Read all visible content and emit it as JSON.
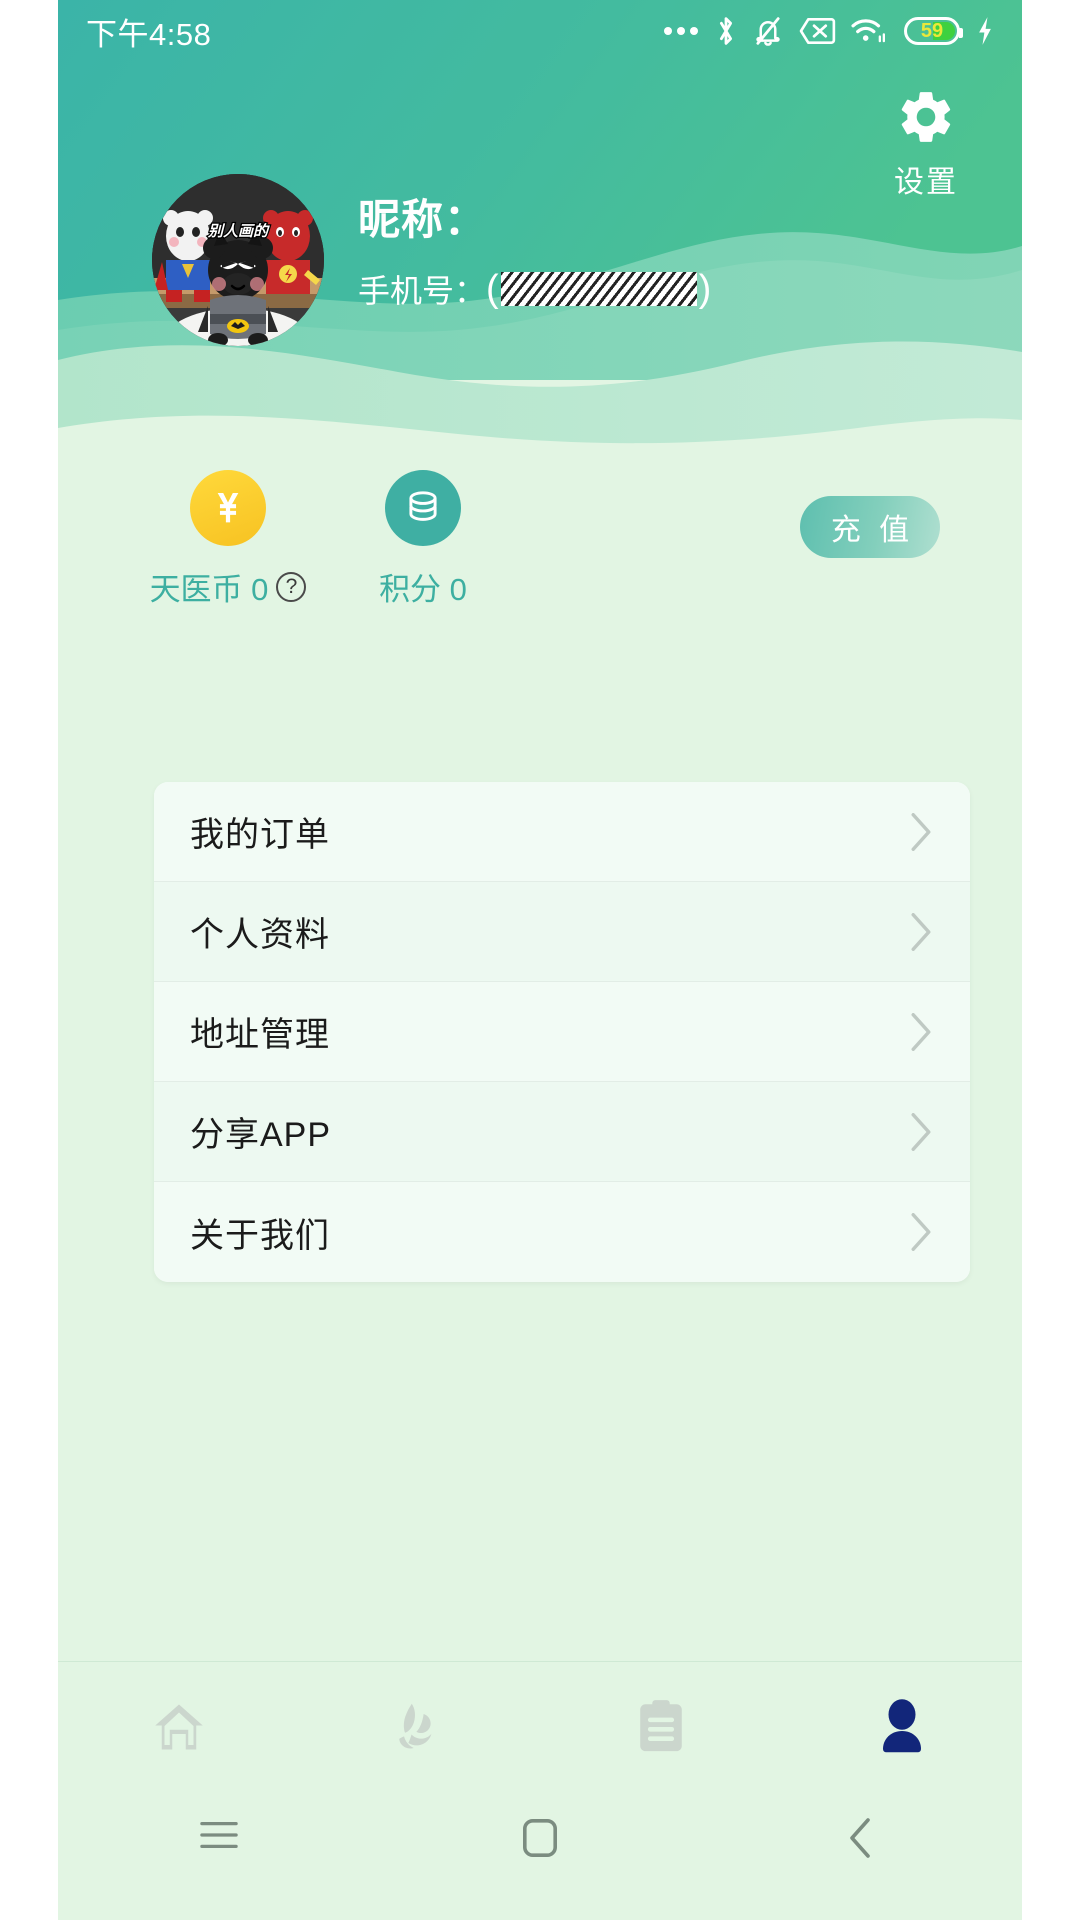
{
  "status_bar": {
    "time": "下午4:58",
    "battery_percent": "59",
    "icons": [
      "more-dots-icon",
      "bluetooth-icon",
      "notifications-muted-icon",
      "sim-disabled-icon",
      "wifi-icon",
      "battery-icon",
      "charging-bolt-icon"
    ]
  },
  "header": {
    "settings_label": "设置",
    "settings_icon": "gear-icon",
    "avatar_icon": "user-avatar-image",
    "avatar_caption": "别人画的",
    "nickname_label": "昵称：",
    "nickname_value": "",
    "phone_label": "手机号：",
    "phone_value_redacted": "(▨▨▨▨▨▨▨▨▨▨▨)"
  },
  "wallet": {
    "coin": {
      "icon": "yuan-coin-icon",
      "label": "天医币 0",
      "help_icon": "question-mark-icon"
    },
    "points": {
      "icon": "coin-stack-icon",
      "label": "积分 0"
    },
    "recharge_button": "充 值"
  },
  "menu": {
    "items": [
      {
        "label": "我的订单",
        "chevron": "chevron-right-icon"
      },
      {
        "label": "个人资料",
        "chevron": "chevron-right-icon"
      },
      {
        "label": "地址管理",
        "chevron": "chevron-right-icon"
      },
      {
        "label": "分享APP",
        "chevron": "chevron-right-icon"
      },
      {
        "label": "关于我们",
        "chevron": "chevron-right-icon"
      }
    ]
  },
  "tabbar": {
    "items": [
      {
        "name": "tab-home",
        "icon": "home-icon",
        "active": false
      },
      {
        "name": "tab-service",
        "icon": "leaf-hand-icon",
        "active": false
      },
      {
        "name": "tab-orders",
        "icon": "clipboard-icon",
        "active": false
      },
      {
        "name": "tab-profile",
        "icon": "person-icon",
        "active": true
      }
    ]
  },
  "navbar": {
    "items": [
      {
        "name": "nav-recents",
        "icon": "hamburger-icon"
      },
      {
        "name": "nav-home",
        "icon": "square-icon"
      },
      {
        "name": "nav-back",
        "icon": "chevron-left-icon"
      }
    ]
  },
  "colors": {
    "header_gradient_start": "#3BB4A8",
    "header_gradient_end": "#4DC392",
    "wave_mid": "#7FD2B4",
    "wave_light": "#B6E6CE",
    "page_bg": "#E2F5E3",
    "card_bg": "#F2FBF5",
    "accent_teal": "#3DAFA1",
    "coin_yellow": "#FFD300",
    "active_tab": "#12267A",
    "inactive_tab": "#CBD6CD",
    "battery_green": "#3FD13F"
  }
}
